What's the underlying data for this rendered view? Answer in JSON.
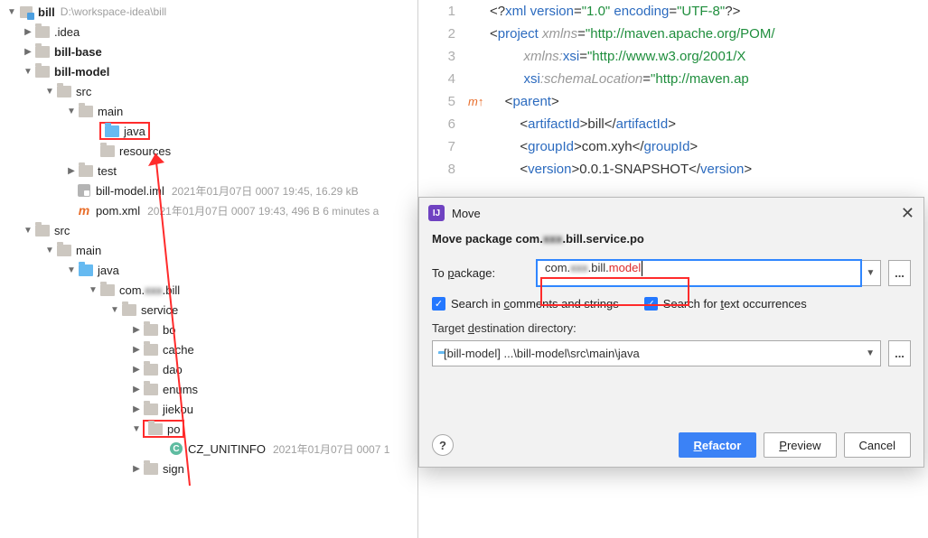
{
  "tree": {
    "root": {
      "name": "bill",
      "path": "D:\\workspace-idea\\bill"
    },
    "idea": ".idea",
    "billbase": "bill-base",
    "billmodel": "bill-model",
    "src1": "src",
    "main1": "main",
    "java1": "java",
    "resources": "resources",
    "test": "test",
    "iml": {
      "name": "bill-model.iml",
      "meta": "2021年01月07日 0007 19:45, 16.29 kB"
    },
    "pom": {
      "name": "pom.xml",
      "meta": "2021年01月07日 0007 19:43, 496 B 6 minutes a"
    },
    "src2": "src",
    "main2": "main",
    "java2": "java",
    "pkg_prefix": "com.",
    "pkg_blur": "xxx",
    "pkg_suffix": ".bill",
    "service": "service",
    "bo": "bo",
    "cache": "cache",
    "dao": "dao",
    "enums": "enums",
    "jiekou": "jiekou",
    "po": "po",
    "cls": {
      "name": "CZ_UNITINFO",
      "meta": "2021年01月07日 0007 1"
    },
    "sign": "sign"
  },
  "editor": {
    "lines": [
      {
        "n": "1",
        "html": "<span class='txt'>&lt;?</span><span class='kw'>xml version</span><span class='txt'>=</span><span class='str'>\"1.0\"</span> <span class='kw'>encoding</span><span class='txt'>=</span><span class='str'>\"UTF-8\"</span><span class='txt'>?&gt;</span>"
      },
      {
        "n": "2",
        "html": "<span class='txt'>&lt;</span><span class='kw'>project</span> <span class='attr'>xmlns</span><span class='txt'>=</span><span class='str'>\"http://maven.apache.org/POM/</span>"
      },
      {
        "n": "3",
        "html": "         <span class='attr'>xmlns:</span><span class='kw'>xsi</span><span class='txt'>=</span><span class='str'>\"http://www.w3.org/2001/X</span>"
      },
      {
        "n": "4",
        "html": "         <span class='kw'>xsi</span><span class='attr'>:schemaLocation</span><span class='txt'>=</span><span class='str'>\"http://maven.ap</span>"
      },
      {
        "n": "5",
        "mark": "m↑",
        "html": "    <span class='txt'>&lt;</span><span class='kw'>parent</span><span class='txt'>&gt;</span>"
      },
      {
        "n": "6",
        "html": "        <span class='txt'>&lt;</span><span class='kw'>artifactId</span><span class='txt'>&gt;bill&lt;/</span><span class='kw'>artifactId</span><span class='txt'>&gt;</span>"
      },
      {
        "n": "7",
        "html": "        <span class='txt'>&lt;</span><span class='kw'>groupId</span><span class='txt'>&gt;com.xyh&lt;/</span><span class='kw'>groupId</span><span class='txt'>&gt;</span>"
      },
      {
        "n": "8",
        "html": "        <span class='txt'>&lt;</span><span class='kw'>version</span><span class='txt'>&gt;0.0.1-SNAPSHOT&lt;/</span><span class='kw'>version</span><span class='txt'>&gt;</span>"
      }
    ]
  },
  "dialog": {
    "title": "Move",
    "heading_pre": "Move package com.",
    "heading_blur": "xxx",
    "heading_post": ".bill.service.po",
    "to_label": "To package:",
    "to_value_pre": "com.",
    "to_value_blur": "xxx",
    "to_value_mid": ".bill.",
    "to_value_red": "model",
    "chk1": "Search in comments and strings",
    "chk2": "Search for text occurrences",
    "dest_label": "Target destination directory:",
    "dest_value": "[bill-model] ...\\bill-model\\src\\main\\java",
    "btn_refactor": "Refactor",
    "btn_preview": "Preview",
    "btn_cancel": "Cancel",
    "ellipsis": "...",
    "help": "?"
  }
}
